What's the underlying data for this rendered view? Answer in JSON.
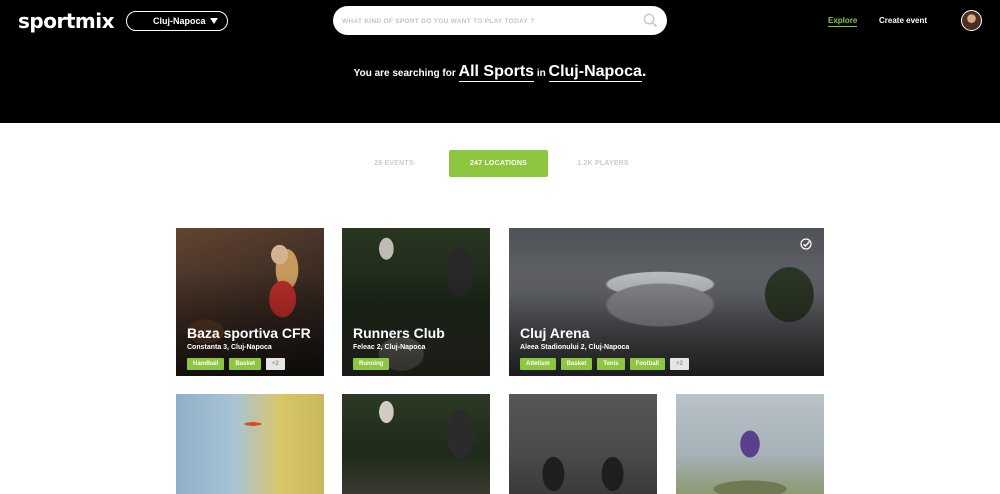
{
  "header": {
    "logo": "sportmix",
    "city": "Cluj-Napoca",
    "search_placeholder": "WHAT KIND OF SPORT DO YOU WANT TO PLAY TODAY ?",
    "nav": {
      "explore": "Explore",
      "create_event": "Create event"
    }
  },
  "hero": {
    "prefix": "You are searching for",
    "sport": "All Sports",
    "in": "in",
    "city": "Cluj-Napoca",
    "suffix": "."
  },
  "tabs": [
    {
      "label": "26 EVENTS",
      "active": false
    },
    {
      "label": "247 LOCATIONS",
      "active": true
    },
    {
      "label": "1.2K PLAYERS",
      "active": false
    }
  ],
  "colors": {
    "accent": "#8dc63f",
    "header_bg": "#000000"
  },
  "cards": [
    {
      "name": "Baza sportiva CFR",
      "address": "Constanta 3, Cluj-Napoca",
      "tags": [
        "Handball",
        "Basket"
      ],
      "more": "+2"
    },
    {
      "name": "Runners Club",
      "address": "Feleac 2, Cluj-Napoca",
      "tags": [
        "Running"
      ],
      "more": ""
    },
    {
      "name": "Cluj Arena",
      "address": "Aleea Stadionului 2, Cluj-Napoca",
      "tags": [
        "Atletism",
        "Basket",
        "Tenis",
        "Football"
      ],
      "more": "+2",
      "checked": true
    }
  ]
}
